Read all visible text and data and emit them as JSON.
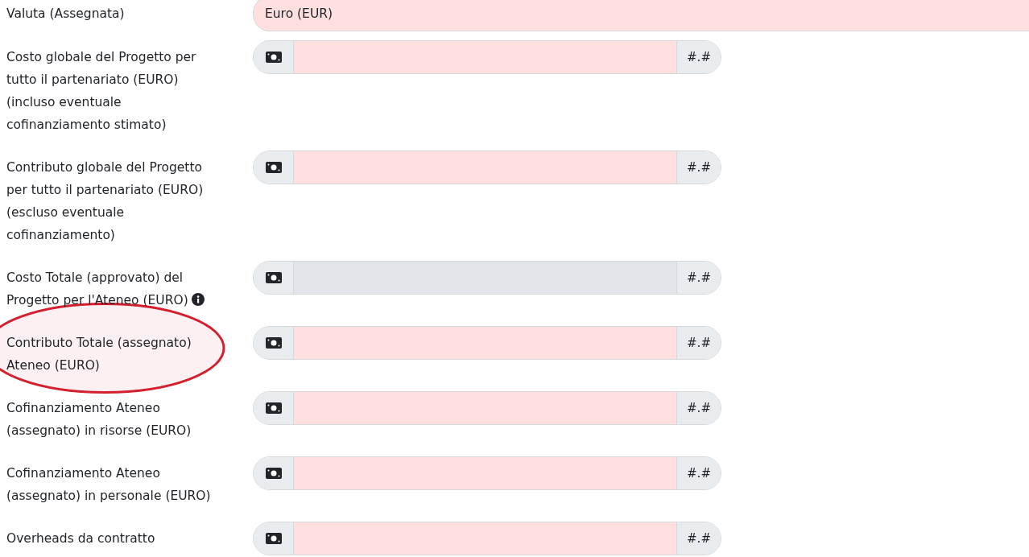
{
  "fields": [
    {
      "kind": "select",
      "label": "Valuta (Assegnata)",
      "value": "Euro (EUR)"
    },
    {
      "kind": "money",
      "label": "Costo globale del Progetto per tutto il partenariato (EURO) (incluso eventuale cofinanziamento stimato)",
      "suffix": "#.#",
      "disabled": false,
      "info": false,
      "circled": false
    },
    {
      "kind": "money",
      "label": "Contributo globale del Progetto per tutto il partenariato (EURO) (escluso eventuale cofinanziamento)",
      "suffix": "#.#",
      "disabled": false,
      "info": false,
      "circled": false
    },
    {
      "kind": "money",
      "label": "Costo Totale (approvato) del Progetto per l'Ateneo (EURO)",
      "suffix": "#.#",
      "disabled": true,
      "info": true,
      "circled": false
    },
    {
      "kind": "money",
      "label": "Contributo Totale (assegnato) Ateneo (EURO)",
      "suffix": "#.#",
      "disabled": false,
      "info": false,
      "circled": true
    },
    {
      "kind": "money",
      "label": "Cofinanziamento Ateneo (assegnato) in risorse (EURO)",
      "suffix": "#.#",
      "disabled": false,
      "info": false,
      "circled": false
    },
    {
      "kind": "money",
      "label": "Cofinanziamento Ateneo (assegnato) in personale (EURO)",
      "suffix": "#.#",
      "disabled": false,
      "info": false,
      "circled": false
    },
    {
      "kind": "money",
      "label": "Overheads da contratto",
      "suffix": "#.#",
      "disabled": false,
      "info": false,
      "circled": false
    }
  ]
}
